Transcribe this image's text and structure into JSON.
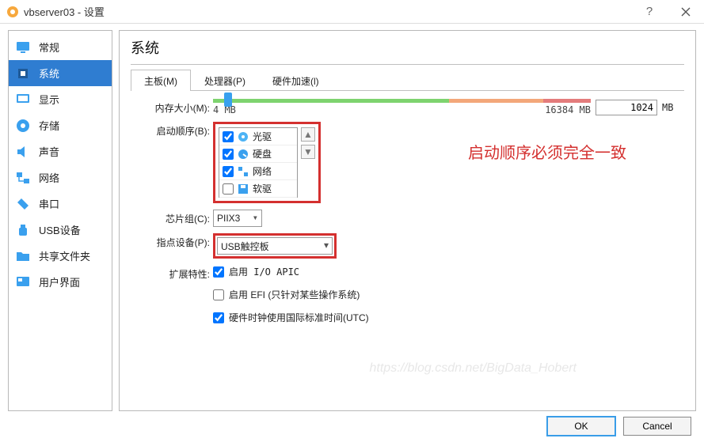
{
  "window": {
    "title": "vbserver03 - 设置"
  },
  "sidebar": {
    "items": [
      {
        "label": "常规"
      },
      {
        "label": "系统"
      },
      {
        "label": "显示"
      },
      {
        "label": "存储"
      },
      {
        "label": "声音"
      },
      {
        "label": "网络"
      },
      {
        "label": "串口"
      },
      {
        "label": "USB设备"
      },
      {
        "label": "共享文件夹"
      },
      {
        "label": "用户界面"
      }
    ],
    "active_index": 1
  },
  "page": {
    "title": "系统"
  },
  "tabs": [
    {
      "label": "主板(M)"
    },
    {
      "label": "处理器(P)"
    },
    {
      "label": "硬件加速(l)"
    }
  ],
  "active_tab_index": 0,
  "memory": {
    "label": "内存大小(M):",
    "value": "1024",
    "unit": "MB",
    "min_label": "4 MB",
    "max_label": "16384 MB"
  },
  "boot": {
    "label": "启动顺序(B):",
    "items": [
      {
        "checked": true,
        "label": "光驱"
      },
      {
        "checked": true,
        "label": "硬盘"
      },
      {
        "checked": true,
        "label": "网络"
      },
      {
        "checked": false,
        "label": "软驱"
      }
    ],
    "note": "启动顺序必须完全一致"
  },
  "chipset": {
    "label": "芯片组(C):",
    "value": "PIIX3"
  },
  "pointer": {
    "label": "指点设备(P):",
    "value": "USB触控板"
  },
  "ext": {
    "label": "扩展特性:",
    "items": [
      {
        "checked": true,
        "label": "启用 I/O APIC"
      },
      {
        "checked": false,
        "label": "启用 EFI (只针对某些操作系统)"
      },
      {
        "checked": true,
        "label": "硬件时钟使用国际标准时间(UTC)"
      }
    ]
  },
  "buttons": {
    "ok": "OK",
    "cancel": "Cancel"
  },
  "watermark": "https://blog.csdn.net/BigData_Hobert"
}
